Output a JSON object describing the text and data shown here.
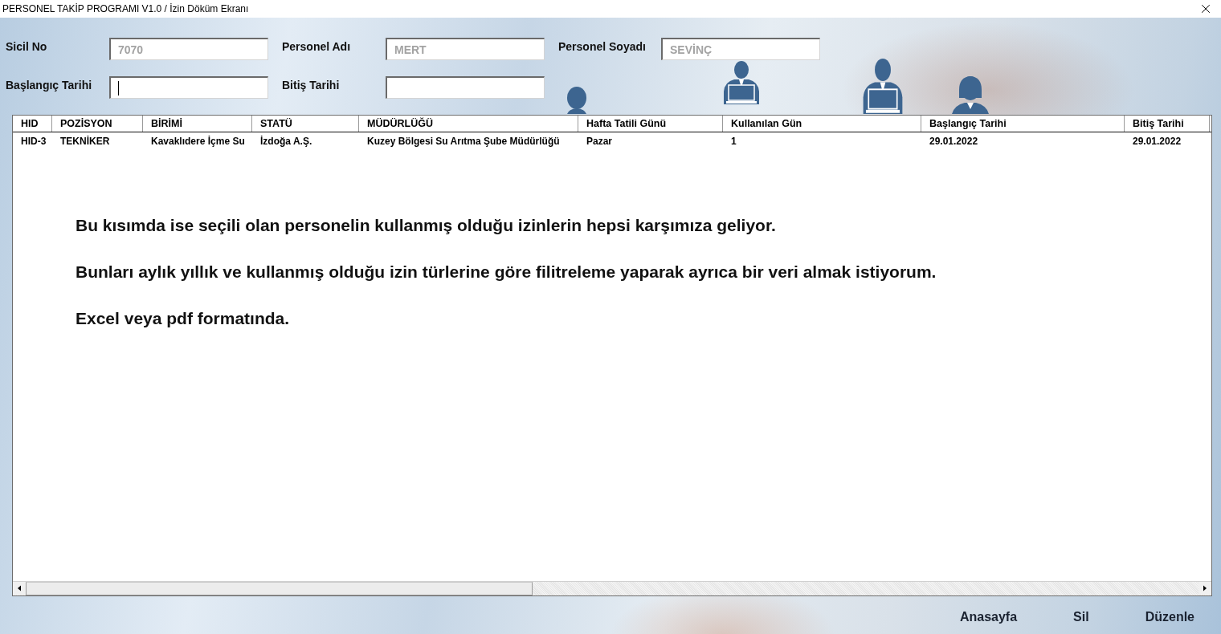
{
  "window": {
    "title": "PERSONEL TAKİP PROGRAMI V1.0 / İzin Döküm Ekranı"
  },
  "form": {
    "rows": [
      [
        {
          "label": "Sicil No",
          "value": "7070",
          "disabled": true,
          "focused": false
        },
        {
          "label": "Personel Adı",
          "value": "MERT",
          "disabled": true,
          "focused": false
        },
        {
          "label": "Personel Soyadı",
          "value": "SEVİNÇ",
          "disabled": true,
          "focused": false
        }
      ],
      [
        {
          "label": "Başlangıç Tarihi",
          "focused": true
        },
        {
          "label": "Bitiş Tarihi",
          "focused": false
        }
      ]
    ]
  },
  "table": {
    "columns": [
      "HID",
      "POZİSYON",
      "BİRİMİ",
      "STATÜ",
      "MÜDÜRLÜĞÜ",
      "Hafta Tatili Günü",
      "Kullanılan Gün",
      "Başlangıç Tarihi",
      "Bitiş Tarihi"
    ],
    "rows": [
      [
        "HID-3",
        "TEKNİKER",
        "Kavaklıdere İçme Su",
        "İzdoğa A.Ş.",
        "Kuzey Bölgesi Su Arıtma Şube Müdürlüğü",
        "Pazar",
        "1",
        "29.01.2022",
        "29.01.2022"
      ]
    ]
  },
  "notes": [
    "Bu kısımda ise seçili olan personelin kullanmış olduğu izinlerin hepsi karşımıza geliyor.",
    "Bunları aylık yıllık ve kullanmış olduğu izin türlerine göre filitreleme yaparak ayrıca bir veri almak istiyorum.",
    "Excel veya pdf formatında."
  ],
  "buttons": [
    "Anasayfa",
    "Sil",
    "Düzenle"
  ]
}
